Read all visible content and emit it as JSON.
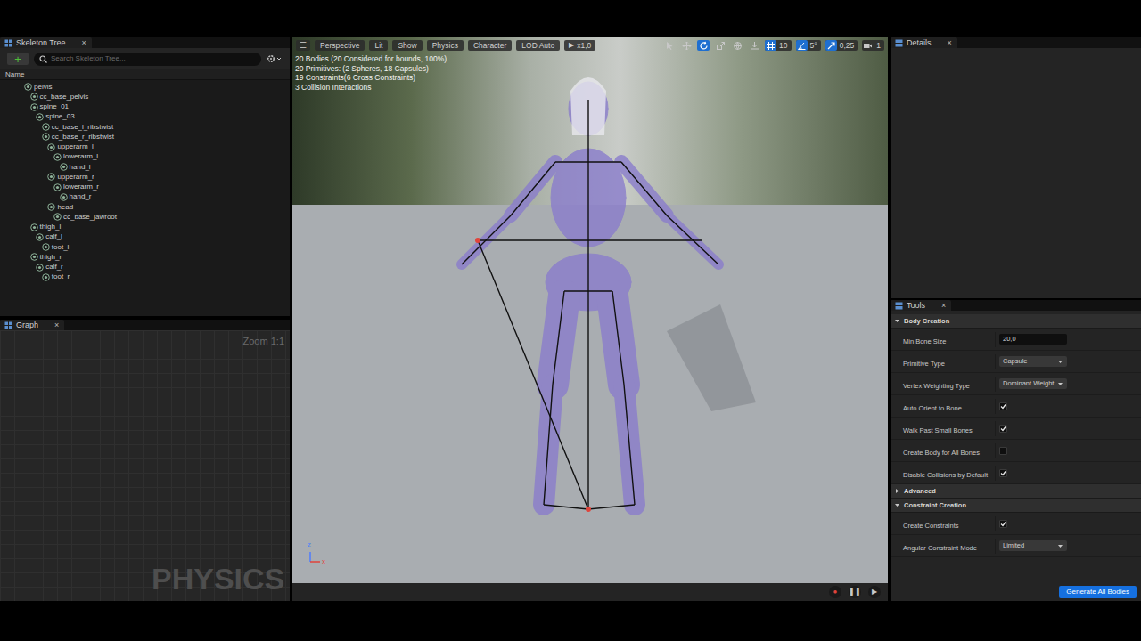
{
  "skeleton_tree": {
    "tab": "Skeleton Tree",
    "close": "×",
    "add": "+",
    "search_placeholder": "Search Skeleton Tree...",
    "column": "Name",
    "bones": [
      {
        "name": "pelvis",
        "children": [
          {
            "name": "cc_base_pelvis",
            "children": []
          },
          {
            "name": "spine_01",
            "children": [
              {
                "name": "spine_03",
                "children": [
                  {
                    "name": "cc_base_l_ribstwist",
                    "children": []
                  },
                  {
                    "name": "cc_base_r_ribstwist",
                    "children": [
                      {
                        "name": "upperarm_l",
                        "children": [
                          {
                            "name": "lowerarm_l",
                            "children": [
                              {
                                "name": "hand_l",
                                "children": []
                              }
                            ]
                          }
                        ]
                      },
                      {
                        "name": "upperarm_r",
                        "children": [
                          {
                            "name": "lowerarm_r",
                            "children": [
                              {
                                "name": "hand_r",
                                "children": []
                              }
                            ]
                          }
                        ]
                      },
                      {
                        "name": "head",
                        "children": [
                          {
                            "name": "cc_base_jawroot",
                            "children": []
                          }
                        ]
                      }
                    ]
                  }
                ]
              }
            ]
          },
          {
            "name": "thigh_l",
            "children": [
              {
                "name": "calf_l",
                "children": [
                  {
                    "name": "foot_l",
                    "children": []
                  }
                ]
              }
            ]
          },
          {
            "name": "thigh_r",
            "children": [
              {
                "name": "calf_r",
                "children": [
                  {
                    "name": "foot_r",
                    "children": []
                  }
                ]
              }
            ]
          }
        ]
      }
    ]
  },
  "graph": {
    "tab": "Graph",
    "close": "×",
    "zoom": "Zoom 1:1",
    "watermark": "PHYSICS"
  },
  "viewport": {
    "menu": "☰",
    "toolbar": [
      "Perspective",
      "Lit",
      "Show",
      "Physics",
      "Character",
      "LOD Auto"
    ],
    "speed": {
      "icon": "▶",
      "label": "x1,0"
    },
    "transform_tools": [
      {
        "kind": "select",
        "selected": false
      },
      {
        "kind": "move",
        "selected": false
      },
      {
        "kind": "rotate",
        "selected": true
      },
      {
        "kind": "scale",
        "selected": false
      },
      {
        "kind": "world",
        "selected": false
      },
      {
        "kind": "surface",
        "selected": false
      }
    ],
    "snap": [
      {
        "kind": "grid",
        "value": "10",
        "on": true
      },
      {
        "kind": "angle",
        "value": "5°",
        "on": true
      },
      {
        "kind": "scale",
        "value": "0,25",
        "on": true
      },
      {
        "kind": "camera",
        "value": "1",
        "on": false
      }
    ],
    "stats": [
      "20 Bodies (20 Considered for bounds, 100%)",
      "20 Primitives: (2 Spheres, 18 Capsules)",
      "19 Constraints(6 Cross Constraints)",
      "3 Collision Interactions"
    ],
    "axis": [
      {
        "label": "z",
        "color": "#4f7dff"
      },
      {
        "label": "x",
        "color": "#e0443c"
      }
    ]
  },
  "playback": [
    {
      "icon": "●",
      "color": "#e0443c"
    },
    {
      "icon": "❚❚",
      "color": "#c8c8c8"
    },
    {
      "icon": "▶",
      "color": "#c8c8c8"
    }
  ],
  "details": {
    "tab": "Details",
    "close": "×"
  },
  "tools": {
    "tab": "Tools",
    "close": "×",
    "sections": [
      {
        "title": "Body Creation",
        "expanded": true,
        "rows": [
          {
            "label": "Min Bone Size",
            "kind": "number",
            "value": "20,0"
          },
          {
            "label": "Primitive Type",
            "kind": "dropdown",
            "value": "Capsule"
          },
          {
            "label": "Vertex Weighting Type",
            "kind": "dropdown",
            "value": "Dominant Weight"
          },
          {
            "label": "Auto Orient to Bone",
            "kind": "checkbox",
            "checked": true
          },
          {
            "label": "Walk Past Small Bones",
            "kind": "checkbox",
            "checked": true
          },
          {
            "label": "Create Body for All Bones",
            "kind": "checkbox",
            "checked": false
          },
          {
            "label": "Disable Collisions by Default",
            "kind": "checkbox",
            "checked": true
          }
        ]
      },
      {
        "title": "Advanced",
        "expanded": false,
        "rows": []
      },
      {
        "title": "Constraint Creation",
        "expanded": true,
        "rows": [
          {
            "label": "Create Constraints",
            "kind": "checkbox",
            "checked": true
          },
          {
            "label": "Angular Constraint Mode",
            "kind": "dropdown",
            "value": "Limited"
          }
        ]
      }
    ],
    "button": "Generate All Bodies"
  }
}
